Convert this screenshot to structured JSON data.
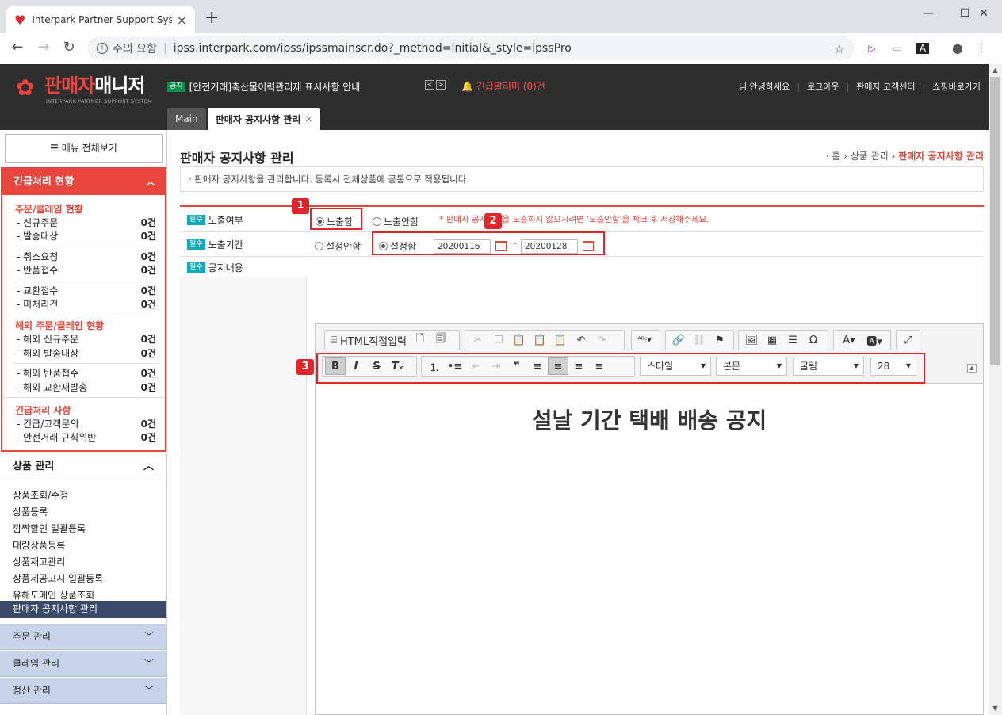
{
  "browser": {
    "tab_title": "Interpark Partner Support System",
    "new_tab": "+",
    "security_label": "주의 요함",
    "url": "ipss.interpark.com/ipss/ipssmainscr.do?_method=initial&_style=ipssPro",
    "win_min": "—",
    "win_max": "☐",
    "win_close": "✕"
  },
  "header": {
    "logo_red": "판매자",
    "logo_white": "매니저",
    "logo_sub": "INTERPARK PARTNER SUPPORT SYSTEM",
    "notice_tag": "공지",
    "notice_text": "[안전거래]축산물이력관리제 표시사항 안내",
    "alert_text": "긴급알리미 (0)건",
    "links": [
      "님 안녕하세요",
      "로그아웃",
      "판매자 고객센터",
      "쇼핑바로가기"
    ],
    "tabs": [
      "Main",
      "판매자 공지사항 관리"
    ]
  },
  "sidebar": {
    "menu_all": "메뉴 전체보기",
    "urgent_title": "긴급처리 현황",
    "groups": [
      {
        "title": "주문/클레임 현황"
      },
      {
        "title": "해외 주문/클레임 현황"
      },
      {
        "title": "긴급처리 사항"
      }
    ],
    "rows": [
      {
        "label": "- 신규주문",
        "count": "0건"
      },
      {
        "label": "- 발송대상",
        "count": "0건"
      },
      {
        "label": "- 취소요청",
        "count": "0건"
      },
      {
        "label": "- 반품접수",
        "count": "0건"
      },
      {
        "label": "- 교환접수",
        "count": "0건"
      },
      {
        "label": "- 미처리건",
        "count": "0건"
      },
      {
        "label": "- 해외 신규주문",
        "count": "0건"
      },
      {
        "label": "- 해외 발송대상",
        "count": "0건"
      },
      {
        "label": "- 해외 반품접수",
        "count": "0건"
      },
      {
        "label": "- 해외 교환재발송",
        "count": "0건"
      },
      {
        "label": "- 긴급/고객문의",
        "count": "0건"
      },
      {
        "label": "- 안전거래 규칙위반",
        "count": "0건"
      }
    ],
    "product_title": "상품 관리",
    "product_items": [
      "상품조회/수정",
      "상품등록",
      "깜짝할인 일괄등록",
      "대량상품등록",
      "상품재고관리",
      "상품제공고시 일괄등록",
      "유해도메인 상품조회"
    ],
    "product_active": "판매자 공지사항 관리",
    "closed": [
      "주문 관리",
      "클레임 관리",
      "정산 관리"
    ]
  },
  "content": {
    "title": "판매자 공지사항 관리",
    "crumb_home": "· 홈",
    "crumb_mid": "상품 관리",
    "crumb_cur": "판매자 공지사항 관리",
    "description": "· 판매자 공지사항을 관리합니다. 등록시 전체상품에 공통으로 적용됩니다.",
    "req": "필수",
    "label_expose": "노출여부",
    "label_period": "노출기간",
    "label_content": "공지내용",
    "opt_expose_on": "노출함",
    "opt_expose_off": "노출안함",
    "hint": "* 판매자 공지사항을 노출하지 않으시려면 '노출안함'을 체크 후 저장해주세요.",
    "opt_period_off": "설정안함",
    "opt_period_on": "설정함",
    "date_from": "20200116",
    "date_tilde": "~",
    "date_to": "20200128",
    "badges": [
      "1",
      "2",
      "3"
    ]
  },
  "editor": {
    "html_btn": "HTML직접입력",
    "style_combo": "스타일",
    "format_combo": "본문",
    "font_combo": "굴림",
    "size_combo": "28",
    "body_text": "설날 기간 택배 배송 공지"
  },
  "colors": {
    "accent": "#e8453c",
    "header_bg": "#2e2e2e",
    "req_badge": "#16a8b8",
    "active_menu": "#3b4a6b"
  }
}
